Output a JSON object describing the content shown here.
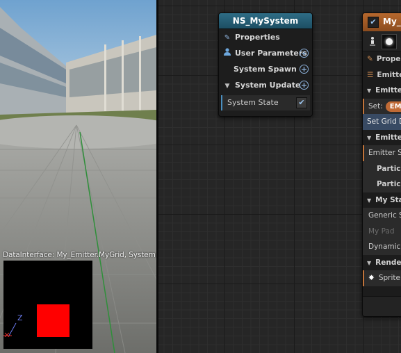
{
  "viewport": {
    "data_interface_label": "DataInterface: My_Emitter.MyGrid, System: N",
    "axis_label": "Z",
    "preview_square_color": "#ff0000"
  },
  "system_node": {
    "title": "NS_MySystem",
    "rows": [
      {
        "label": "Properties",
        "icon": "pencil-icon"
      },
      {
        "label": "User Parameters",
        "icon": "user-icon"
      },
      {
        "label": "System Spawn"
      },
      {
        "label": "System Update",
        "collapsed": false
      }
    ],
    "state_row": {
      "label": "System State",
      "checked": true
    }
  },
  "emitter_node": {
    "title": "My_",
    "enabled": true,
    "rows": {
      "properties": "Propert",
      "emitter_summary": "Emitter",
      "emitter_spawn_header": "Emitter",
      "set_label": "Set:",
      "set_pill": "EM",
      "set_grid": "Set Grid D",
      "emitter_update_header": "Emitter",
      "emitter_s": "Emitter S",
      "particle_1": "Particle",
      "particle_2": "Particle",
      "my_stage_header": "My Sta",
      "generic": "Generic S",
      "my_pad": "My Pad",
      "dynamic": "Dynamic",
      "render_header": "Render",
      "sprite": "Sprite"
    }
  }
}
